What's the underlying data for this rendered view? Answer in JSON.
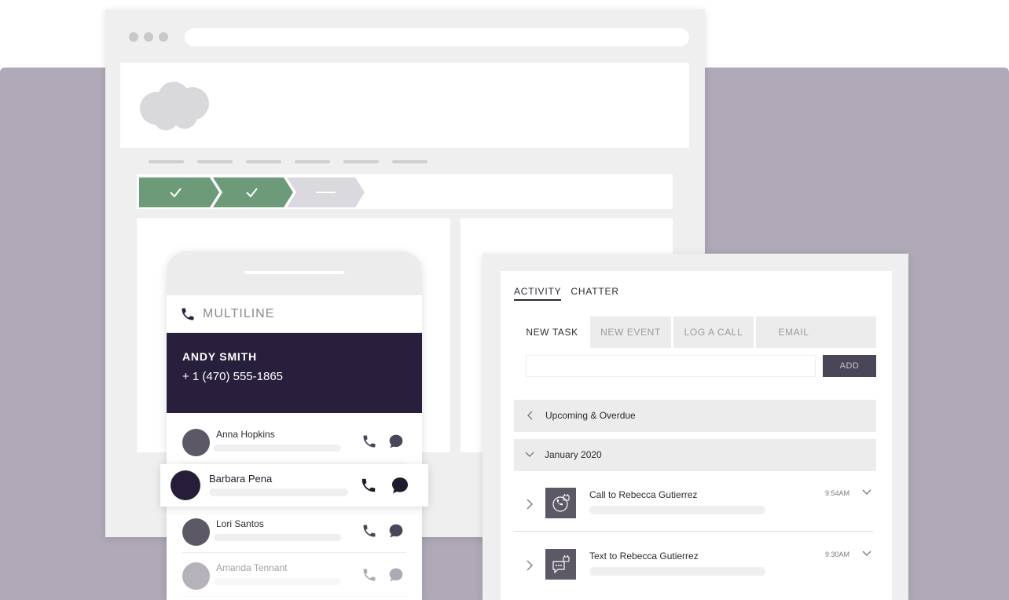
{
  "phone": {
    "app_label": "MULTILINE",
    "contact": {
      "name": "ANDY SMITH",
      "phone": "+ 1 (470) 555-1865"
    },
    "contacts": [
      {
        "name": "Anna Hopkins"
      },
      {
        "name": "Barbara Pena"
      },
      {
        "name": "Lori Santos"
      },
      {
        "name": "Amanda Tennant"
      }
    ]
  },
  "activity": {
    "tabs": [
      "ACTIVITY",
      "CHATTER"
    ],
    "publisher_tabs": [
      "NEW TASK",
      "NEW EVENT",
      "LOG A CALL",
      "EMAIL"
    ],
    "add_label": "ADD",
    "sections": [
      "Upcoming & Overdue",
      "January 2020"
    ],
    "items": [
      {
        "title": "Call to Rebecca Gutierrez",
        "time": "9:54AM",
        "icon": "call-log-icon"
      },
      {
        "title": "Text to Rebecca Gutierrez",
        "time": "9:30AM",
        "icon": "text-log-icon"
      }
    ]
  },
  "colors": {
    "background": "#b0a9b8",
    "path_complete": "#6d9a78",
    "contact_card": "#281f3c",
    "button": "#4b4558"
  }
}
